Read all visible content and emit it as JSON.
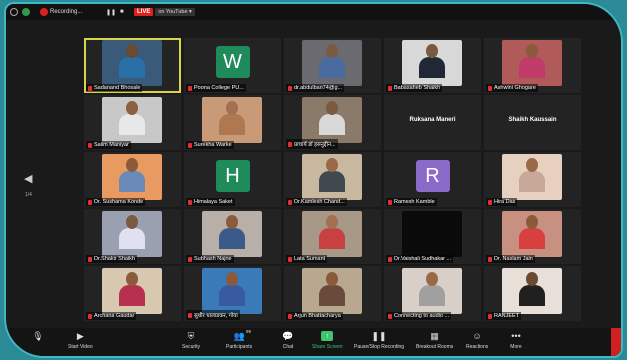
{
  "topbar": {
    "recording_label": "Recording...",
    "live_label": "LIVE",
    "youtube_label": "on YouTube ▾"
  },
  "side": {
    "page_indicator": "1/4"
  },
  "participants": [
    {
      "name": "Sadanand Bhosale",
      "kind": "video",
      "bg": "#3a5a7a",
      "skin": "#6a4a30",
      "shirt": "#2a70a8",
      "active": true
    },
    {
      "name": "Poona College PU...",
      "kind": "avatar",
      "letter": "W",
      "color": "#1f8a5a"
    },
    {
      "name": "dr.abdulbari74@g...",
      "kind": "video",
      "bg": "#6a6a70",
      "skin": "#7a5a40",
      "shirt": "#4a6aa0"
    },
    {
      "name": "Babasaheb Shaikh",
      "kind": "video",
      "bg": "#d8d8d8",
      "skin": "#7a5a40",
      "shirt": "#202838"
    },
    {
      "name": "Ashwini Ghogare",
      "kind": "video",
      "bg": "#b05a5a",
      "skin": "#8a5a3a",
      "shirt": "#c03a6a"
    },
    {
      "name": "Salim Maniyar",
      "kind": "video",
      "bg": "#c8c8c8",
      "skin": "#8a6040",
      "shirt": "#e8e8e8"
    },
    {
      "name": "Surekha Warke",
      "kind": "video",
      "bg": "#c89a78",
      "skin": "#a07050",
      "shirt": "#b07850"
    },
    {
      "name": "प्राचार्य डॉ हसनुद्दीन...",
      "kind": "video",
      "bg": "#8a7a6a",
      "skin": "#7a5a40",
      "shirt": "#d8d8d8"
    },
    {
      "name": "Ruksana Maneri",
      "kind": "textonly"
    },
    {
      "name": "Shaikh Kaussain",
      "kind": "textonly"
    },
    {
      "name": "Dr. Sushama Konde",
      "kind": "video",
      "bg": "#e89a60",
      "skin": "#8a5a3a",
      "shirt": "#6a8ab8"
    },
    {
      "name": "Himalaya Saket",
      "kind": "avatar",
      "letter": "H",
      "color": "#1f8a5a"
    },
    {
      "name": "Dr.Kamlesh Chand...",
      "kind": "video",
      "bg": "#c8b8a0",
      "skin": "#9a6a48",
      "shirt": "#404850"
    },
    {
      "name": "Ramesh Kamble",
      "kind": "avatar",
      "letter": "R",
      "color": "#8a6ac8"
    },
    {
      "name": "Hira Das",
      "kind": "video",
      "bg": "#e8d0c0",
      "skin": "#9a6a48",
      "shirt": "#c8a898"
    },
    {
      "name": "Dr.Shakir Shaikh",
      "kind": "video",
      "bg": "#9aa0b0",
      "skin": "#7a5a40",
      "shirt": "#e0e0f0"
    },
    {
      "name": "Subhash Najne",
      "kind": "video",
      "bg": "#b8b0a8",
      "skin": "#8a5a3a",
      "shirt": "#3a5a8a"
    },
    {
      "name": "Lata Sumant",
      "kind": "video",
      "bg": "#a89888",
      "skin": "#a07050",
      "shirt": "#c84040"
    },
    {
      "name": "Dr.Vaishali Sudhakar ...",
      "kind": "video",
      "bg": "#0a0a0a",
      "skin": "#0a0a0a",
      "shirt": "#0a0a0a"
    },
    {
      "name": "Dr. Naslam Jain",
      "kind": "video",
      "bg": "#c89080",
      "skin": "#8a5a3a",
      "shirt": "#d84040"
    },
    {
      "name": "Archana Gaudar",
      "kind": "video",
      "bg": "#d8c8b0",
      "skin": "#8a5a3a",
      "shirt": "#b83050"
    },
    {
      "name": "सुधीर धालाडकर, गोवा",
      "kind": "video",
      "bg": "#3a7ab8",
      "skin": "#8a5a3a",
      "shirt": "#3a5aa0"
    },
    {
      "name": "Arjun Bhattacharya",
      "kind": "video",
      "bg": "#b8a890",
      "skin": "#8a5a3a",
      "shirt": "#6a4a3a"
    },
    {
      "name": "Connecting to audio ...",
      "kind": "video",
      "bg": "#d8d0c8",
      "skin": "#9a6a48",
      "shirt": "#a0a0a0"
    },
    {
      "name": "RANJEET",
      "kind": "video",
      "bg": "#e8e0d8",
      "skin": "#6a4a30",
      "shirt": "#202020"
    }
  ],
  "toolbar": {
    "start_video": "Start Video",
    "security": "Security",
    "participants": "Participants",
    "participants_count": "99",
    "chat": "Chat",
    "share_screen": "Share Screen",
    "pause_recording": "Pause/Stop Recording",
    "breakout_rooms": "Breakout Rooms",
    "reactions": "Reactions",
    "more": "More"
  },
  "colors": {
    "frame_border": "#3fb8c4",
    "active_speaker": "#d9d34a",
    "share_green": "#3ec46d",
    "live_red": "#e02020"
  }
}
